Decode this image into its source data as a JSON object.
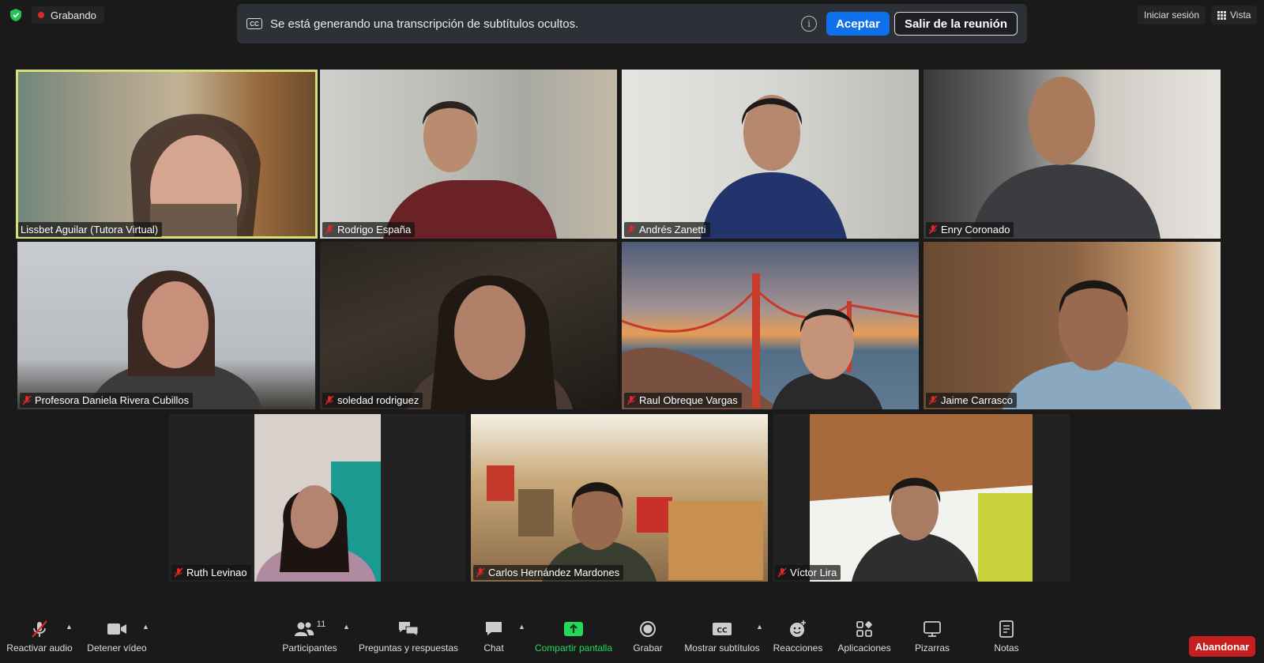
{
  "topbar": {
    "recording_label": "Grabando",
    "banner_text": "Se está generando una transcripción de subtítulos ocultos.",
    "accept_label": "Aceptar",
    "exit_label": "Salir de la reunión",
    "signin_label": "Iniciar sesión",
    "view_label": "Vista",
    "cc_badge": "CC"
  },
  "participants": [
    {
      "name": "Lissbet Aguilar (Tutora Virtual)",
      "muted": false,
      "active": true
    },
    {
      "name": "Rodrigo España",
      "muted": true
    },
    {
      "name": "Andrés Zanetti",
      "muted": true
    },
    {
      "name": "Enry Coronado",
      "muted": true
    },
    {
      "name": "Profesora Daniela Rivera Cubillos",
      "muted": true
    },
    {
      "name": "soledad rodriguez",
      "muted": true
    },
    {
      "name": "Raul Obreque Vargas",
      "muted": true
    },
    {
      "name": "Jaime Carrasco",
      "muted": true
    },
    {
      "name": "Ruth Levinao",
      "muted": true
    },
    {
      "name": "Carlos Hernández Mardones",
      "muted": true
    },
    {
      "name": "Víctor Lira",
      "muted": true
    }
  ],
  "toolbar": {
    "audio_label": "Reactivar audio",
    "video_label": "Detener vídeo",
    "participants_label": "Participantes",
    "participants_count": "11",
    "qa_label": "Preguntas y respuestas",
    "chat_label": "Chat",
    "share_label": "Compartir pantalla",
    "record_label": "Grabar",
    "captions_label": "Mostrar subtítulos",
    "reactions_label": "Reacciones",
    "apps_label": "Aplicaciones",
    "whiteboards_label": "Pizarras",
    "notes_label": "Notas",
    "leave_label": "Abandonar"
  },
  "colors": {
    "accent_blue": "#0e71eb",
    "leave_red": "#c51f1f",
    "share_green": "#23d959",
    "active_speaker": "#d6e07a",
    "mute_red": "#e02828"
  }
}
